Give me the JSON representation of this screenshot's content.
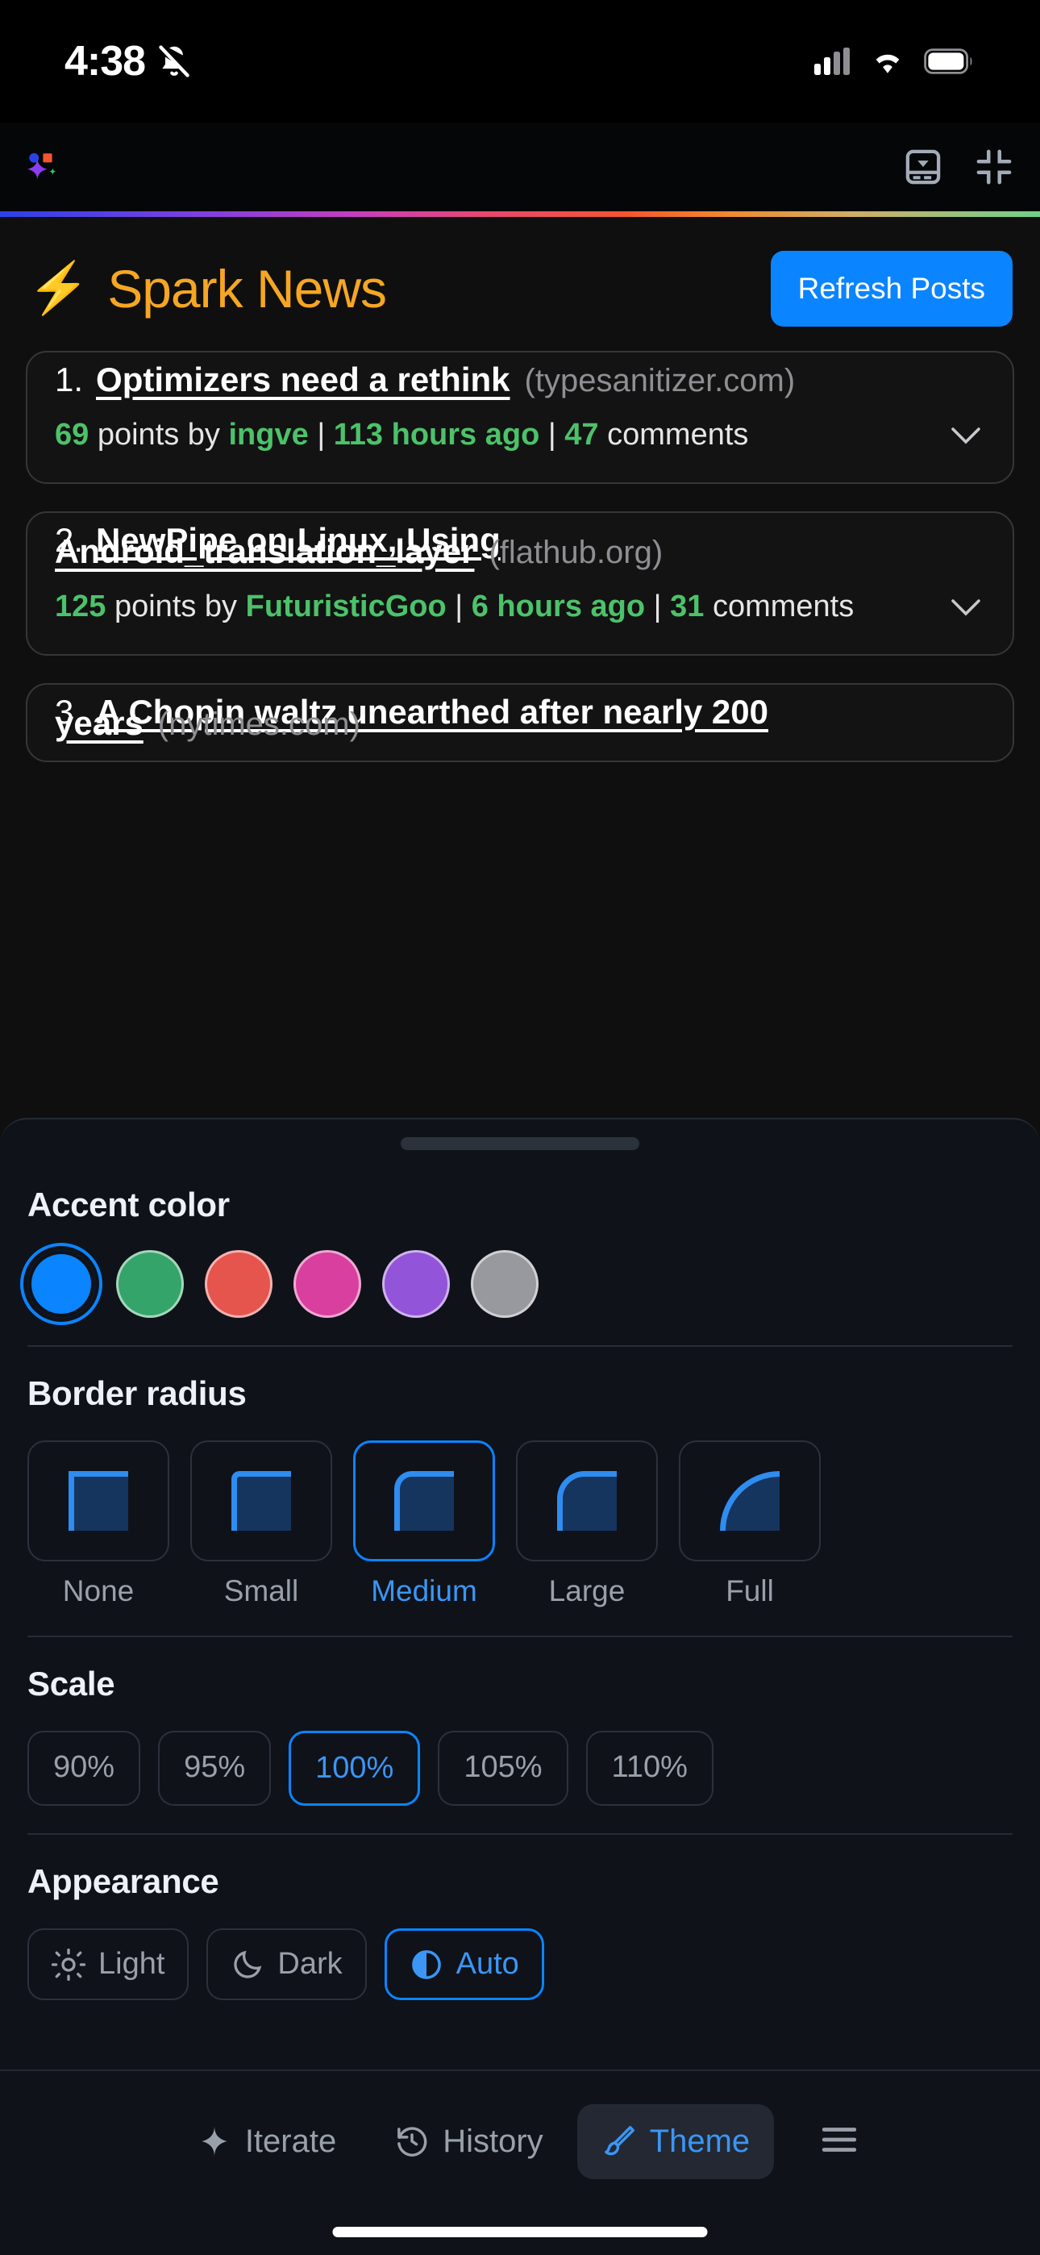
{
  "status_bar": {
    "time": "4:38",
    "mute_icon": "bell-slash-icon",
    "cellular_icon": "cellular-signal-icon",
    "wifi_icon": "wifi-icon",
    "battery_icon": "battery-icon"
  },
  "chrome": {
    "logo_icon": "app-logo-icon",
    "panel_icon": "toggle-bottom-panel-icon",
    "collapse_icon": "collapse-fullscreen-icon"
  },
  "app": {
    "bolt_icon": "lightning-bolt-icon",
    "title": "Spark News",
    "refresh_label": "Refresh Posts",
    "posts": [
      {
        "rank": "1.",
        "title": "Optimizers need a rethink",
        "domain": "(typesanitizer.com)",
        "points": "69",
        "points_label": "points by",
        "author": "ingve",
        "time": "113 hours ago",
        "comments_count": "47",
        "comments_label": "comments",
        "expand_icon": "chevron-down-icon"
      },
      {
        "rank": "2.",
        "title": "NewPipe on Linux, Using Android_translation_layer",
        "domain": "(flathub.org)",
        "points": "125",
        "points_label": "points by",
        "author": "FuturisticGoo",
        "time": "6 hours ago",
        "comments_count": "31",
        "comments_label": "comments",
        "expand_icon": "chevron-down-icon"
      },
      {
        "rank": "3.",
        "title": "A Chopin waltz unearthed after nearly 200 years",
        "domain": "(nytimes.com)"
      }
    ]
  },
  "sheet": {
    "grabber": "sheet-drag-handle",
    "accent": {
      "title": "Accent color",
      "selected_index": 0,
      "colors": [
        "#0a84ff",
        "#35a46b",
        "#e5544d",
        "#d93f9e",
        "#9254d8",
        "#98989f"
      ]
    },
    "border_radius": {
      "title": "Border radius",
      "selected": "Medium",
      "options": [
        {
          "label": "None",
          "radius": "0px"
        },
        {
          "label": "Small",
          "radius": "10px"
        },
        {
          "label": "Medium",
          "radius": "22px"
        },
        {
          "label": "Large",
          "radius": "34px"
        },
        {
          "label": "Full",
          "radius": "74px"
        }
      ]
    },
    "scale": {
      "title": "Scale",
      "selected": "100%",
      "options": [
        "90%",
        "95%",
        "100%",
        "105%",
        "110%"
      ]
    },
    "appearance": {
      "title": "Appearance",
      "selected": "Auto",
      "options": [
        {
          "label": "Light",
          "icon": "sun-icon"
        },
        {
          "label": "Dark",
          "icon": "moon-icon"
        },
        {
          "label": "Auto",
          "icon": "half-circle-icon"
        }
      ]
    }
  },
  "tabbar": {
    "selected": "Theme",
    "tabs": [
      {
        "label": "Iterate",
        "icon": "sparkle-icon"
      },
      {
        "label": "History",
        "icon": "clock-rewind-icon"
      },
      {
        "label": "Theme",
        "icon": "paintbrush-icon"
      }
    ],
    "menu_icon": "hamburger-menu-icon"
  }
}
